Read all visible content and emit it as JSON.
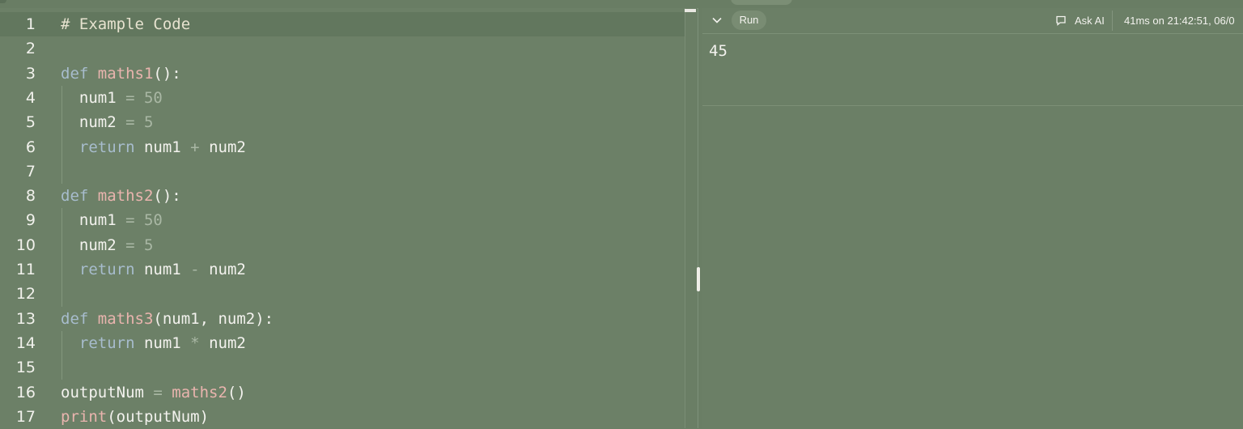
{
  "editor": {
    "lines": [
      {
        "n": "1",
        "tokens": [
          [
            "# Example Code",
            "comment"
          ]
        ]
      },
      {
        "n": "2",
        "tokens": []
      },
      {
        "n": "3",
        "tokens": [
          [
            "def ",
            "kw"
          ],
          [
            "maths1",
            "fn"
          ],
          [
            "():",
            "plain"
          ]
        ]
      },
      {
        "n": "4",
        "tokens": [
          [
            "  num1 ",
            "plain"
          ],
          [
            "= ",
            "op"
          ],
          [
            "50",
            "num"
          ]
        ]
      },
      {
        "n": "5",
        "tokens": [
          [
            "  num2 ",
            "plain"
          ],
          [
            "= ",
            "op"
          ],
          [
            "5",
            "num"
          ]
        ]
      },
      {
        "n": "6",
        "tokens": [
          [
            "  ",
            "plain"
          ],
          [
            "return ",
            "kw"
          ],
          [
            "num1 ",
            "plain"
          ],
          [
            "+ ",
            "op"
          ],
          [
            "num2",
            "plain"
          ]
        ]
      },
      {
        "n": "7",
        "tokens": []
      },
      {
        "n": "8",
        "tokens": [
          [
            "def ",
            "kw"
          ],
          [
            "maths2",
            "fn"
          ],
          [
            "():",
            "plain"
          ]
        ]
      },
      {
        "n": "9",
        "tokens": [
          [
            "  num1 ",
            "plain"
          ],
          [
            "= ",
            "op"
          ],
          [
            "50",
            "num"
          ]
        ]
      },
      {
        "n": "10",
        "tokens": [
          [
            "  num2 ",
            "plain"
          ],
          [
            "= ",
            "op"
          ],
          [
            "5",
            "num"
          ]
        ]
      },
      {
        "n": "11",
        "tokens": [
          [
            "  ",
            "plain"
          ],
          [
            "return ",
            "kw"
          ],
          [
            "num1 ",
            "plain"
          ],
          [
            "- ",
            "op"
          ],
          [
            "num2",
            "plain"
          ]
        ]
      },
      {
        "n": "12",
        "tokens": []
      },
      {
        "n": "13",
        "tokens": [
          [
            "def ",
            "kw"
          ],
          [
            "maths3",
            "fn"
          ],
          [
            "(num1, num2):",
            "plain"
          ]
        ]
      },
      {
        "n": "14",
        "tokens": [
          [
            "  ",
            "plain"
          ],
          [
            "return ",
            "kw"
          ],
          [
            "num1 ",
            "plain"
          ],
          [
            "* ",
            "op"
          ],
          [
            "num2",
            "plain"
          ]
        ]
      },
      {
        "n": "15",
        "tokens": []
      },
      {
        "n": "16",
        "tokens": [
          [
            "outputNum ",
            "plain"
          ],
          [
            "= ",
            "op"
          ],
          [
            "maths2",
            "fn"
          ],
          [
            "()",
            "plain"
          ]
        ]
      },
      {
        "n": "17",
        "tokens": [
          [
            "print",
            "fn"
          ],
          [
            "(outputNum)",
            "plain"
          ]
        ]
      }
    ]
  },
  "console": {
    "run_label": "Run",
    "ask_ai_label": "Ask AI",
    "timing": "41ms on 21:42:51, 06/0",
    "output": "45"
  },
  "icons": {
    "collapse": "chevron-down-icon",
    "ask_ai": "chat-bubble-icon"
  }
}
